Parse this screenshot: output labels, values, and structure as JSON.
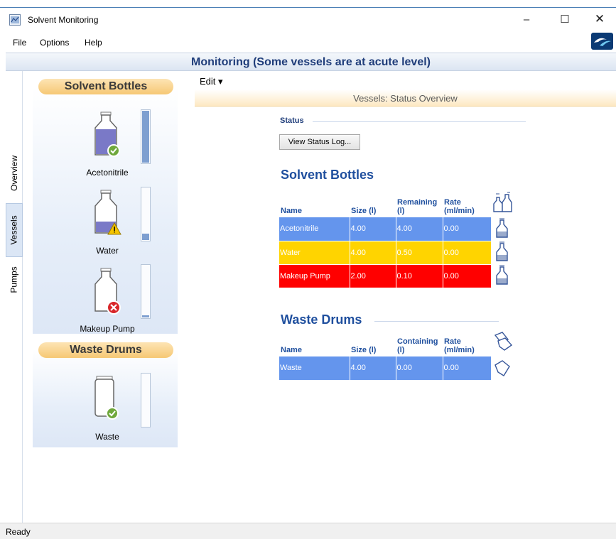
{
  "window": {
    "title": "Solvent Monitoring",
    "minimize": "–",
    "maximize": "☐",
    "close": "✕"
  },
  "menubar": {
    "file": "File",
    "options": "Options",
    "help": "Help"
  },
  "header": {
    "text": "Monitoring (Some vessels are at acute level)"
  },
  "tabs": {
    "overview": "Overview",
    "vessels": "Vessels",
    "pumps": "Pumps",
    "active": "Vessels"
  },
  "left_panel": {
    "solvent_bottles_heading": "Solvent Bottles",
    "waste_drums_heading": "Waste Drums",
    "bottles": [
      {
        "label": "Acetonitrile",
        "status": "ok",
        "level_fraction": 1.0
      },
      {
        "label": "Water",
        "status": "warning",
        "level_fraction": 0.125
      },
      {
        "label": "Makeup Pump",
        "status": "error",
        "level_fraction": 0.05
      }
    ],
    "drums": [
      {
        "label": "Waste",
        "status": "ok",
        "level_fraction": 0.0
      }
    ]
  },
  "edit_menu": {
    "label": "Edit ▾"
  },
  "overview": {
    "title": "Vessels: Status Overview"
  },
  "status_section": {
    "label": "Status",
    "view_log_button": "View Status Log..."
  },
  "solvent_bottles_table": {
    "title": "Solvent Bottles",
    "headers": {
      "name": "Name",
      "size": "Size (l)",
      "remaining": "Remaining (l)",
      "rate": "Rate (ml/min)"
    },
    "rows": [
      {
        "name": "Acetonitrile",
        "size": "4.00",
        "remaining": "4.00",
        "rate": "0.00",
        "state": "ok"
      },
      {
        "name": "Water",
        "size": "4.00",
        "remaining": "0.50",
        "rate": "0.00",
        "state": "warning"
      },
      {
        "name": "Makeup Pump",
        "size": "2.00",
        "remaining": "0.10",
        "rate": "0.00",
        "state": "critical"
      }
    ]
  },
  "waste_drums_table": {
    "title": "Waste Drums",
    "headers": {
      "name": "Name",
      "size": "Size (l)",
      "containing": "Containing (l)",
      "rate": "Rate (ml/min)"
    },
    "rows": [
      {
        "name": "Waste",
        "size": "4.00",
        "containing": "0.00",
        "rate": "0.00",
        "state": "ok"
      }
    ]
  },
  "statusbar": {
    "text": "Ready"
  },
  "colors": {
    "ok": "#6495ed",
    "warning": "#ffd400",
    "critical": "#ff0000",
    "accent": "#1f4f9e"
  }
}
